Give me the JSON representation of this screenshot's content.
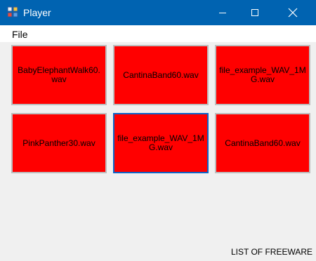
{
  "window": {
    "title": "Player",
    "accent_color": "#0063b1",
    "icons": {
      "app": "app-icon",
      "minimize": "minimize-icon",
      "maximize": "maximize-icon",
      "close": "close-icon"
    }
  },
  "menu": {
    "items": [
      "File"
    ]
  },
  "tiles": [
    {
      "label": "BabyElephantWalk60.wav",
      "color": "#ff0000",
      "selected": false
    },
    {
      "label": "CantinaBand60.wav",
      "color": "#ff0000",
      "selected": false
    },
    {
      "label": "file_example_WAV_1MG.wav",
      "color": "#ff0000",
      "selected": false
    },
    {
      "label": "PinkPanther30.wav",
      "color": "#ff0000",
      "selected": false
    },
    {
      "label": "file_example_WAV_1MG.wav",
      "color": "#ff0000",
      "selected": true
    },
    {
      "label": "CantinaBand60.wav",
      "color": "#ff0000",
      "selected": false
    }
  ],
  "footer": {
    "text": "LIST OF FREEWARE"
  }
}
